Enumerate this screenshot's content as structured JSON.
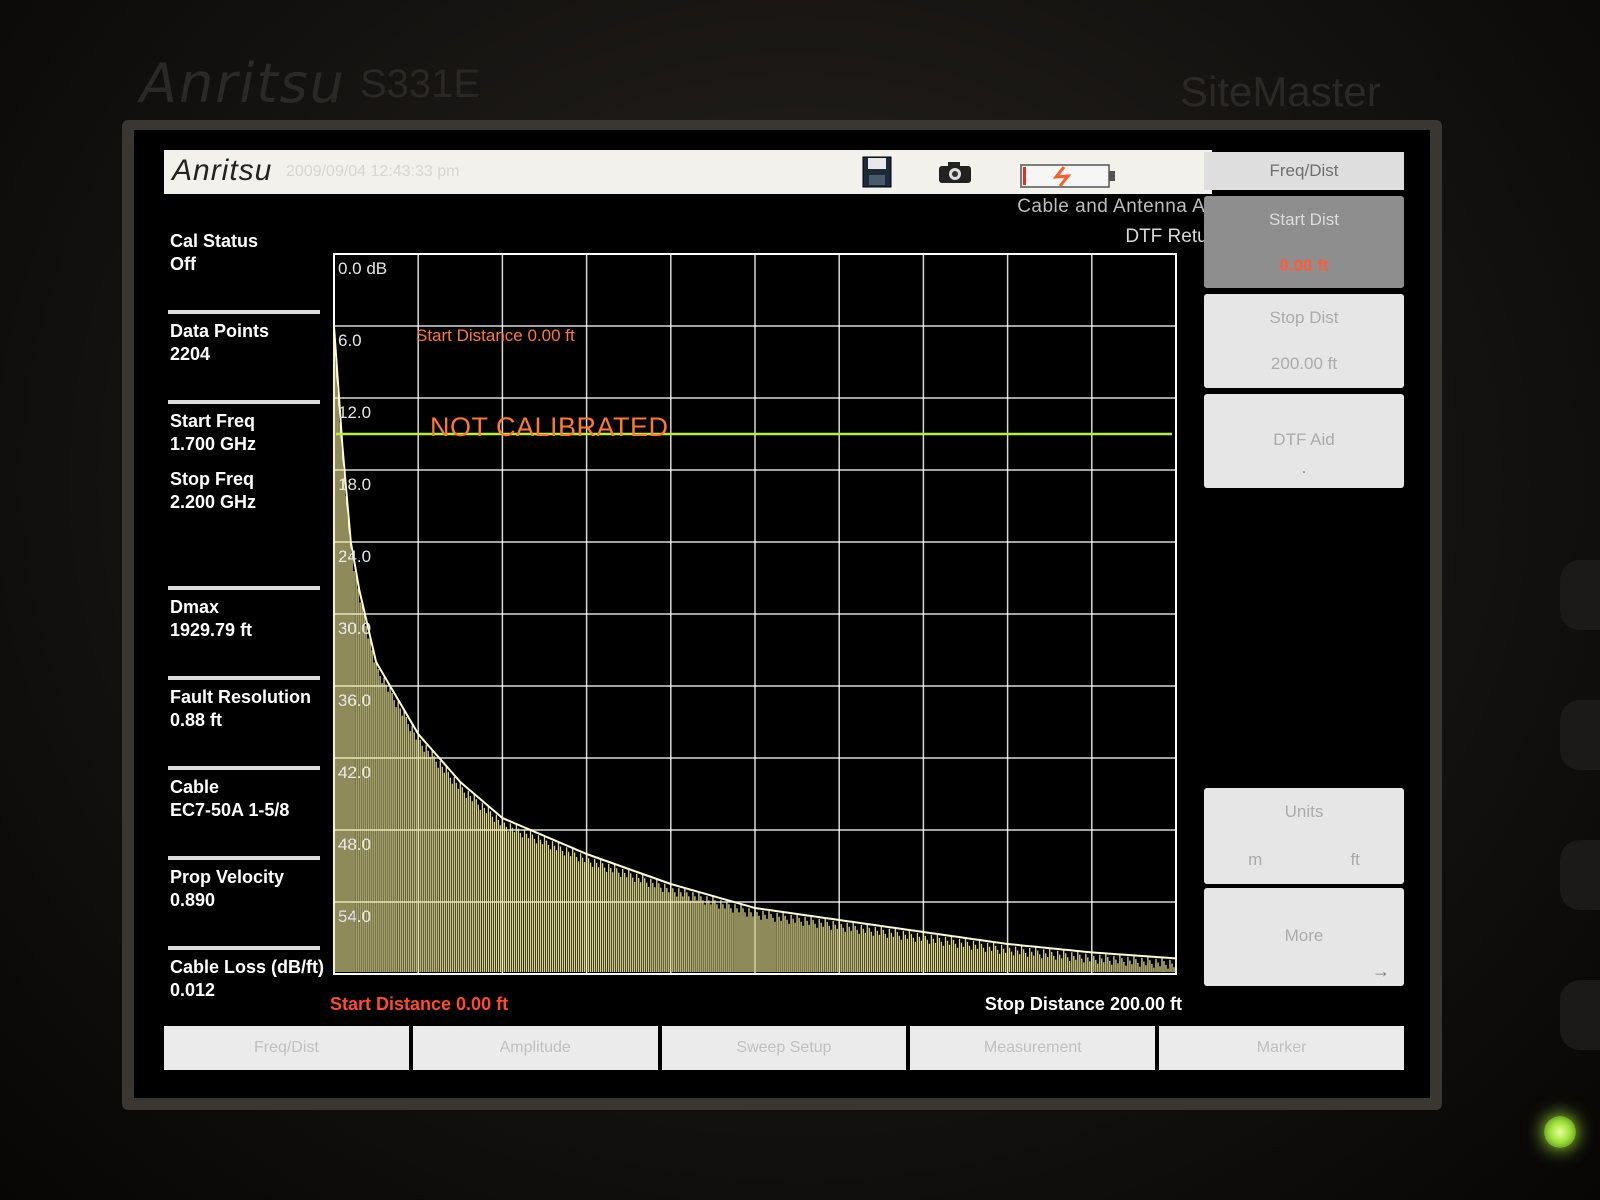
{
  "device": {
    "brand": "Anritsu",
    "model": "S331E",
    "product_line": "SiteMaster"
  },
  "titlebar": {
    "logo": "Anritsu",
    "datetime": "2009/09/04 12:43:33 pm",
    "icons": [
      "save-icon",
      "camera-icon",
      "battery-icon"
    ]
  },
  "mode": {
    "name": "Cable and Antenna Analyzer",
    "measurement": "DTF Return Loss"
  },
  "left_panel": [
    {
      "label": "Cal Status",
      "value": "Off"
    },
    {
      "label": "Data Points",
      "value": "2204"
    },
    {
      "label": "Start Freq",
      "value": "1.700 GHz"
    },
    {
      "label": "Stop Freq",
      "value": "2.200 GHz"
    },
    {
      "label": "Dmax",
      "value": "1929.79 ft"
    },
    {
      "label": "Fault Resolution",
      "value": "0.88 ft"
    },
    {
      "label": "Cable",
      "value": "EC7-50A 1-5/8"
    },
    {
      "label": "Prop Velocity",
      "value": "0.890"
    },
    {
      "label": "Cable Loss (dB/ft)",
      "value": "0.012"
    }
  ],
  "right_panel": {
    "header": "Freq/Dist",
    "buttons": [
      {
        "title": "Start Dist",
        "value": "0.00 ft",
        "active": true
      },
      {
        "title": "Stop Dist",
        "value": "200.00 ft"
      },
      {
        "title": "DTF Aid",
        "value": "."
      },
      {
        "title": "Units",
        "options": [
          "m",
          "ft"
        ]
      },
      {
        "title": "More",
        "arrow": "→"
      }
    ]
  },
  "bottom_tabs": [
    "Freq/Dist",
    "Amplitude",
    "Sweep Setup",
    "Measurement",
    "Marker"
  ],
  "annotations": {
    "start_distance_plot": "Start Distance 0.00 ft",
    "not_calibrated": "NOT CALIBRATED",
    "start_distance_axis": "Start Distance 0.00 ft",
    "stop_distance_axis": "Stop Distance 200.00 ft"
  },
  "colors": {
    "trace": "#f2ec9a",
    "limit_line": "#b9ee3a",
    "warning": "#ff6a2a",
    "grid": "#ffffff",
    "led": "#9ee03a"
  },
  "chart_data": {
    "type": "line",
    "xlim": [
      0,
      200
    ],
    "ylim": [
      0,
      60
    ],
    "y_inverted": true,
    "y_unit": "dB",
    "y_tick_labels": [
      "0.0 dB",
      "6.0",
      "12.0",
      "18.0",
      "24.0",
      "30.0",
      "36.0",
      "42.0",
      "48.0",
      "54.0"
    ],
    "grid": true,
    "x_divisions": 10,
    "y_divisions": 10,
    "limit_line": 15,
    "series": [
      {
        "envelope": [
          {
            "x": 0,
            "y": 6
          },
          {
            "x": 2,
            "y": 16
          },
          {
            "x": 4,
            "y": 24
          },
          {
            "x": 6,
            "y": 28
          },
          {
            "x": 10,
            "y": 34
          },
          {
            "x": 20,
            "y": 40
          },
          {
            "x": 30,
            "y": 44
          },
          {
            "x": 40,
            "y": 47
          },
          {
            "x": 60,
            "y": 50
          },
          {
            "x": 80,
            "y": 52.5
          },
          {
            "x": 100,
            "y": 54.5
          },
          {
            "x": 120,
            "y": 55.5
          },
          {
            "x": 140,
            "y": 56.5
          },
          {
            "x": 160,
            "y": 57.5
          },
          {
            "x": 180,
            "y": 58.2
          },
          {
            "x": 200,
            "y": 58.7
          }
        ]
      }
    ]
  }
}
